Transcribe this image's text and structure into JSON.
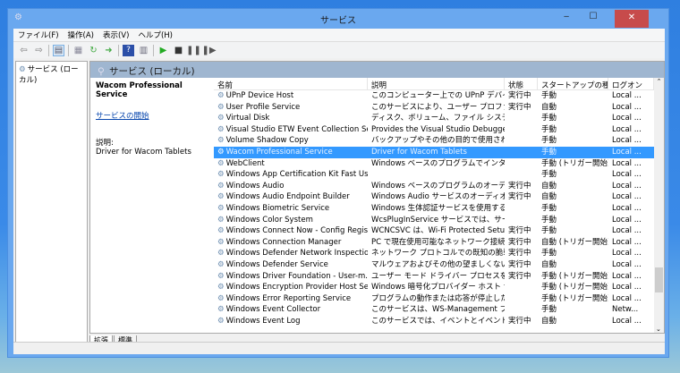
{
  "window": {
    "title": "サービス"
  },
  "menu": [
    "ファイル(F)",
    "操作(A)",
    "表示(V)",
    "ヘルプ(H)"
  ],
  "tree": {
    "root": "サービス (ローカル)"
  },
  "band_title": "サービス (ローカル)",
  "detail": {
    "service_name": "Wacom Professional Service",
    "start_link": "サービスの開始",
    "desc_label": "説明:",
    "description": "Driver for Wacom Tablets"
  },
  "columns": [
    "名前",
    "説明",
    "状態",
    "スタートアップの種類",
    "ログオン"
  ],
  "rows": [
    [
      "UPnP Device Host",
      "このコンピューター上での UPnP デバイスのホ...",
      "実行中",
      "手動",
      "Local ..."
    ],
    [
      "User Profile Service",
      "このサービスにより、ユーザー プロファイルのロ...",
      "実行中",
      "自動",
      "Local ..."
    ],
    [
      "Virtual Disk",
      "ディスク、ボリューム、ファイル システム、および...",
      "",
      "手動",
      "Local ..."
    ],
    [
      "Visual Studio ETW Event Collection Se...",
      "Provides the Visual Studio Debugge...",
      "",
      "手動",
      "Local ..."
    ],
    [
      "Volume Shadow Copy",
      "バックアップやその他の目的で使用されるボリ...",
      "",
      "手動",
      "Local ..."
    ],
    [
      "Wacom Professional Service",
      "Driver for Wacom Tablets",
      "",
      "手動",
      "Local ..."
    ],
    [
      "WebClient",
      "Windows ベースのプログラムでインターネッ...",
      "",
      "手動 (トリガー開始)",
      "Local ..."
    ],
    [
      "Windows App Certification Kit Fast Us...",
      "",
      "",
      "手動",
      "Local ..."
    ],
    [
      "Windows Audio",
      "Windows ベースのプログラムのオーディオを...",
      "実行中",
      "自動",
      "Local ..."
    ],
    [
      "Windows Audio Endpoint Builder",
      "Windows Audio サービスのオーディオ デバ...",
      "実行中",
      "自動",
      "Local ..."
    ],
    [
      "Windows Biometric Service",
      "Windows 生体認証サービスを使用すると、...",
      "",
      "手動",
      "Local ..."
    ],
    [
      "Windows Color System",
      "WcsPlugInService サービスでは、サード ...",
      "",
      "手動",
      "Local ..."
    ],
    [
      "Windows Connect Now - Config Regist...",
      "WCNCSVC は、Wi-Fi Protected Setu...",
      "実行中",
      "手動",
      "Local ..."
    ],
    [
      "Windows Connection Manager",
      "PC で現在使用可能なネットワーク接続オプ...",
      "実行中",
      "自動 (トリガー開始)",
      "Local ..."
    ],
    [
      "Windows Defender Network Inspectio...",
      "ネットワーク プロトコルでの既知の脆弱性や...",
      "実行中",
      "手動",
      "Local ..."
    ],
    [
      "Windows Defender Service",
      "マルウェアおよびその他の望ましくない可能性...",
      "実行中",
      "自動",
      "Local ..."
    ],
    [
      "Windows Driver Foundation - User-m...",
      "ユーザー モード ドライバー プロセスを作成お...",
      "実行中",
      "手動 (トリガー開始)",
      "Local ..."
    ],
    [
      "Windows Encryption Provider Host Se...",
      "Windows 暗号化プロバイダー ホスト サー...",
      "",
      "手動 (トリガー開始)",
      "Local ..."
    ],
    [
      "Windows Error Reporting Service",
      "プログラムの動作または応答が停止したときに...",
      "",
      "手動 (トリガー開始)",
      "Local ..."
    ],
    [
      "Windows Event Collector",
      "このサービスは、WS-Management プロト...",
      "",
      "手動",
      "Netw..."
    ],
    [
      "Windows Event Log",
      "このサービスでは、イベントとイベント ログを管...",
      "実行中",
      "自動",
      "Local ..."
    ]
  ],
  "selected_index": 5,
  "tabs": [
    "拡張",
    "標準"
  ],
  "colors": {
    "selection": "#3399ff",
    "band": "#9fb6d0",
    "close": "#c74b4b"
  }
}
